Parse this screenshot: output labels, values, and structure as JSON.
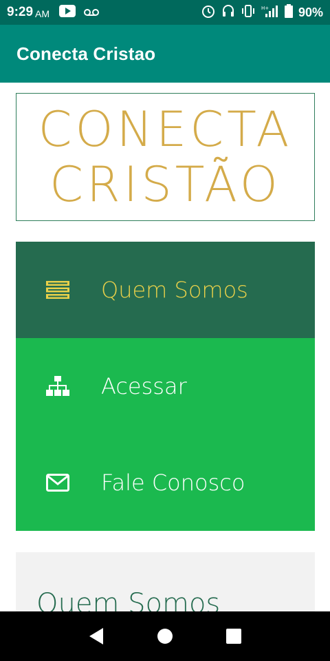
{
  "status_bar": {
    "time": "9:29",
    "ampm": "AM",
    "battery": "90%",
    "left_icons": [
      "youtube-icon",
      "voicemail-icon"
    ],
    "right_icons": [
      "alarm-icon",
      "headset-icon",
      "vibrate-icon",
      "signal-icon",
      "battery-icon"
    ]
  },
  "app_bar": {
    "title": "Conecta Cristao"
  },
  "logo": {
    "line1": "CONECTA",
    "line2": "CRISTÃO"
  },
  "menu": {
    "items": [
      {
        "label": "Quem Somos",
        "icon": "server-icon",
        "active": true
      },
      {
        "label": "Acessar",
        "icon": "sitemap-icon",
        "active": false
      },
      {
        "label": "Fale Conosco",
        "icon": "envelope-icon",
        "active": false
      }
    ]
  },
  "about": {
    "heading": "Quem Somos"
  },
  "colors": {
    "status_bar": "#00695c",
    "app_bar": "#00897b",
    "logo_gold": "#d4ab4a",
    "menu_active": "#256b4f",
    "menu_active_text": "#e8d04a",
    "menu_default": "#1bb94f"
  }
}
